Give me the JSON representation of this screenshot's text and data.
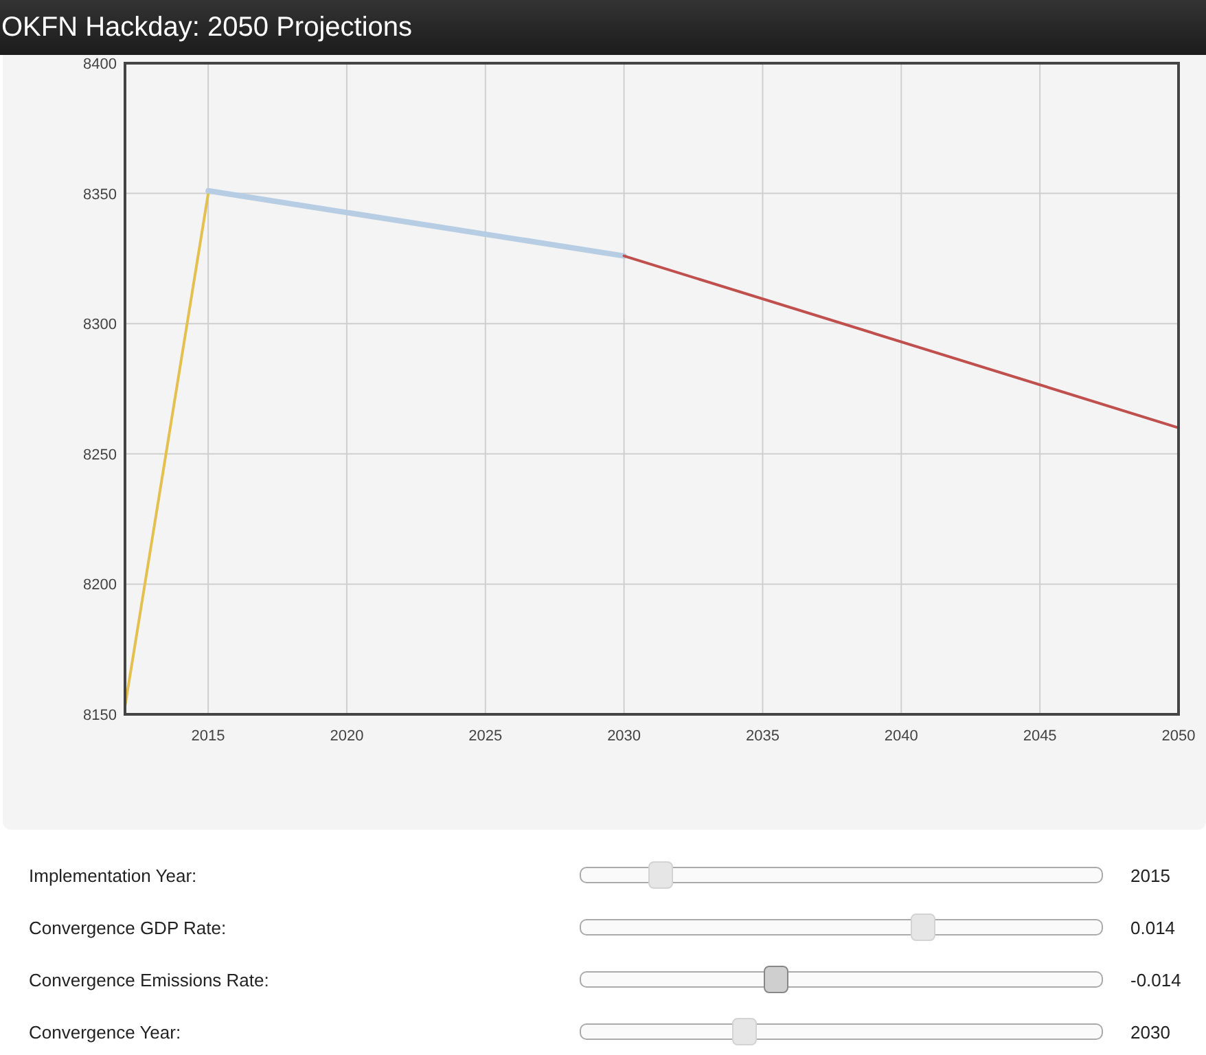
{
  "window": {
    "title": "OKFN Hackday: 2050 Projections"
  },
  "chart": {
    "chart_data": {
      "type": "line",
      "x": [
        2012,
        2015,
        2030,
        2050
      ],
      "series": [
        {
          "color": "#e3c04f",
          "values": [
            8153,
            8350,
            null,
            null
          ]
        },
        {
          "color": "#b7cde3",
          "values": [
            null,
            8351,
            8326,
            null
          ]
        },
        {
          "color": "#c0504d",
          "values": [
            null,
            null,
            8326,
            8260
          ]
        }
      ],
      "xlim": [
        2012,
        2050
      ],
      "ylim": [
        8150,
        8400
      ],
      "xticks": [
        2015,
        2020,
        2025,
        2030,
        2035,
        2040,
        2045,
        2050
      ],
      "yticks": [
        8150,
        8200,
        8250,
        8300,
        8350,
        8400
      ],
      "grid": true
    }
  },
  "controls": [
    {
      "label": "Implementation Year:",
      "level": 0.14,
      "active": false,
      "reading": "2015"
    },
    {
      "label": "Convergence GDP Rate:",
      "level": 0.64,
      "active": false,
      "reading": "0.014"
    },
    {
      "label": "Convergence Emissions Rate:",
      "level": 0.36,
      "active": true,
      "reading": "-0.014"
    },
    {
      "label": "Convergence Year:",
      "level": 0.3,
      "active": false,
      "reading": "2030"
    }
  ]
}
